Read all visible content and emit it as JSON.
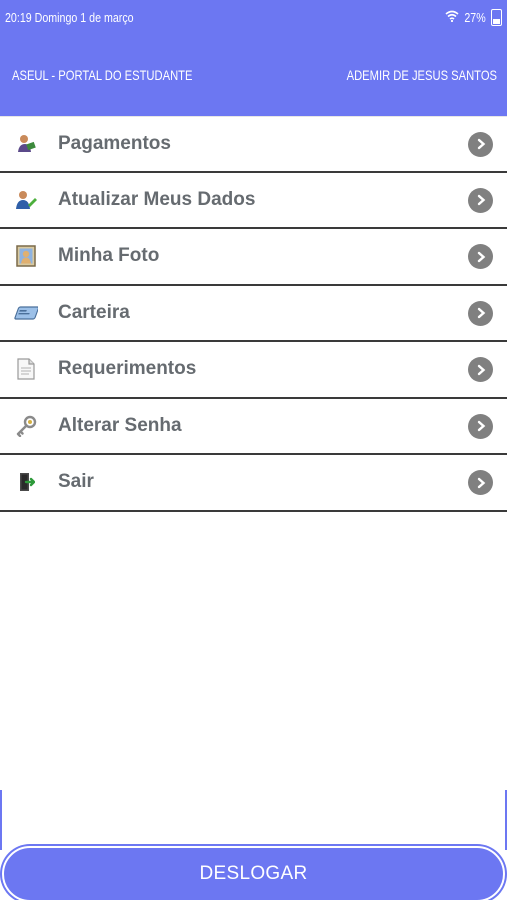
{
  "status_bar": {
    "time_date": "20:19  Domingo 1 de março",
    "battery": "27%"
  },
  "header": {
    "portal_title": "ASEUL - PORTAL DO ESTUDANTE",
    "user_name": "ADEMIR DE JESUS SANTOS"
  },
  "menu": {
    "items": [
      {
        "label": "Pagamentos",
        "icon": "payment-icon"
      },
      {
        "label": "Atualizar Meus Dados",
        "icon": "user-edit-icon"
      },
      {
        "label": "Minha Foto",
        "icon": "photo-icon"
      },
      {
        "label": "Carteira",
        "icon": "card-icon"
      },
      {
        "label": "Requerimentos",
        "icon": "document-icon"
      },
      {
        "label": "Alterar Senha",
        "icon": "key-icon"
      },
      {
        "label": "Sair",
        "icon": "exit-door-icon"
      }
    ]
  },
  "footer": {
    "logout_label": "DESLOGAR"
  },
  "colors": {
    "accent": "#6c77f2",
    "label": "#666b70",
    "chevron": "#808080"
  }
}
